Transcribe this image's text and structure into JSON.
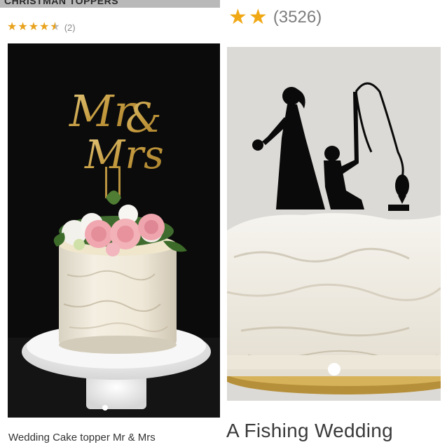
{
  "left_listing": {
    "title_partial": "CHRISTMAN TOPPERS",
    "rating_stars": 4.5,
    "review_count": "(2)",
    "topper_text_line1": "Mr",
    "topper_text_amp": "&",
    "topper_text_line2": "Mrs",
    "caption_partial": "Wedding Cake topper Mr & Mrs",
    "colors": {
      "star": "#e8a21c",
      "background": "#0b0b0b",
      "topper_gold": "#c9a44c"
    }
  },
  "right_listing": {
    "rating_stars": 2,
    "review_count": "(3526)",
    "title_partial": "A  Fishing Wedding",
    "colors": {
      "star": "#f0a814",
      "background": "#dcdad6",
      "silhouette": "#0a0a0a"
    }
  },
  "icons": [
    "star-icon",
    "star-half-icon",
    "carousel-dot-icon"
  ]
}
